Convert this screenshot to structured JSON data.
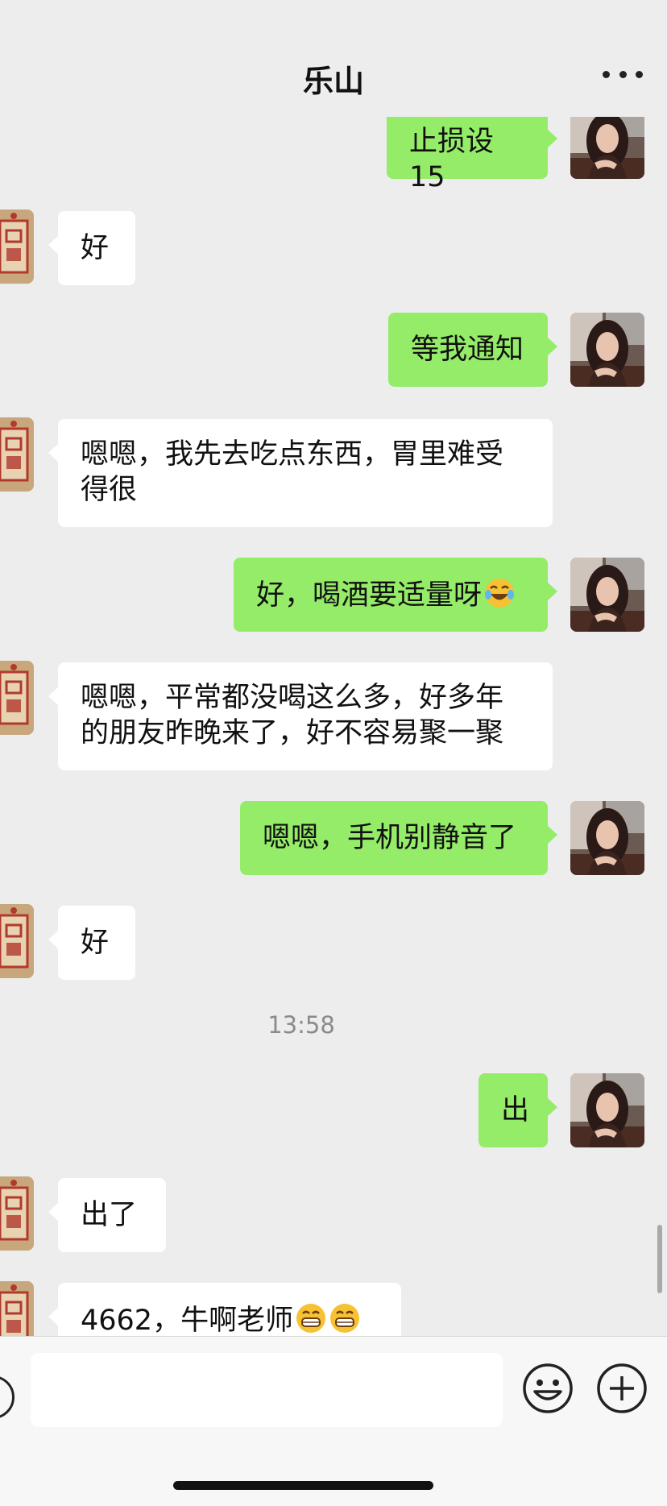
{
  "header": {
    "title": "乐山",
    "more_icon": "more-dots-icon"
  },
  "messages": [
    {
      "side": "out",
      "text": "止损设15"
    },
    {
      "side": "in",
      "text": "好"
    },
    {
      "side": "out",
      "text": "等我通知"
    },
    {
      "side": "in",
      "text": "嗯嗯，我先去吃点东西，胃里难受得很"
    },
    {
      "side": "out",
      "text": "好，喝酒要适量呀",
      "emoji": "rofl-emoji-icon"
    },
    {
      "side": "in",
      "text": "嗯嗯，平常都没喝这么多，好多年的朋友昨晚来了，好不容易聚一聚"
    },
    {
      "side": "out",
      "text": "嗯嗯，手机别静音了"
    },
    {
      "side": "in",
      "text": "好"
    },
    {
      "side": "out",
      "text": "出"
    },
    {
      "side": "in",
      "text": "出了"
    },
    {
      "side": "in",
      "text": "4662，牛啊老师",
      "emoji": "grin-emoji-icon"
    }
  ],
  "timestamp": "13:58",
  "colors": {
    "background": "#ededed",
    "outgoing_bubble": "#95ec69",
    "incoming_bubble": "#ffffff"
  },
  "input_bar": {
    "voice_icon": "voice-icon",
    "emoji_icon": "smiley-face-icon",
    "plus_icon": "plus-circle-icon"
  }
}
